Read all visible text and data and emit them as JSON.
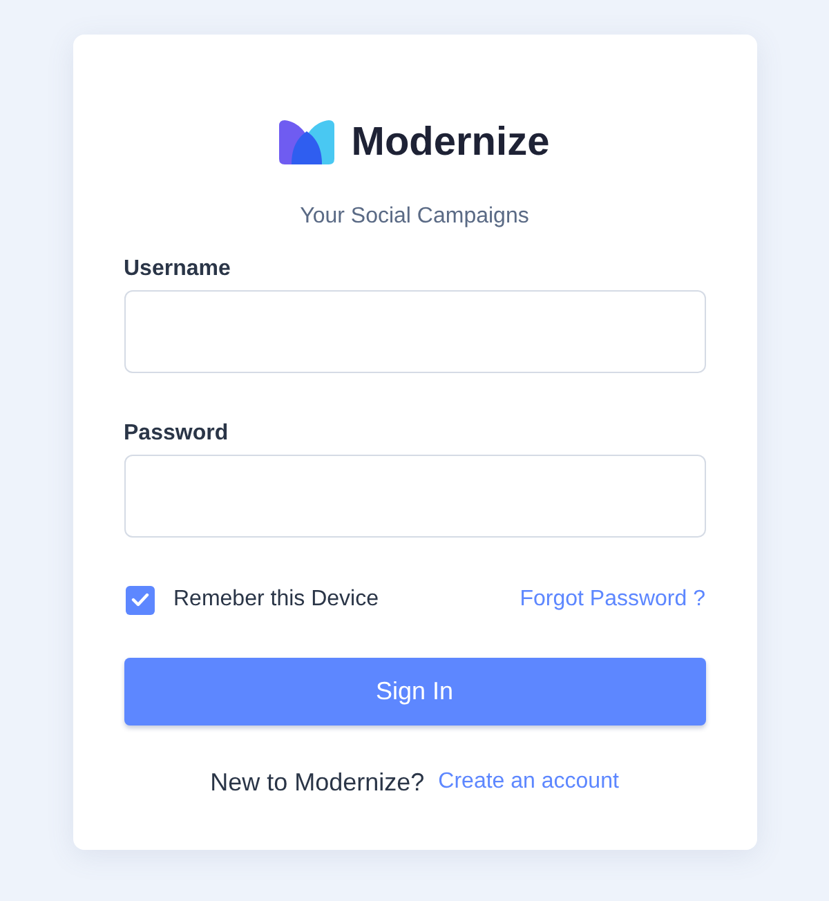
{
  "brand": {
    "name": "Modernize"
  },
  "tagline": "Your Social Campaigns",
  "fields": [
    {
      "label": "Username"
    },
    {
      "label": "Password"
    }
  ],
  "remember": {
    "label": "Remeber this Device",
    "checked": true
  },
  "forgot_link": "Forgot Password ?",
  "submit_button": "Sign In",
  "footer": {
    "text": "New to Modernize?",
    "link": "Create an account"
  }
}
